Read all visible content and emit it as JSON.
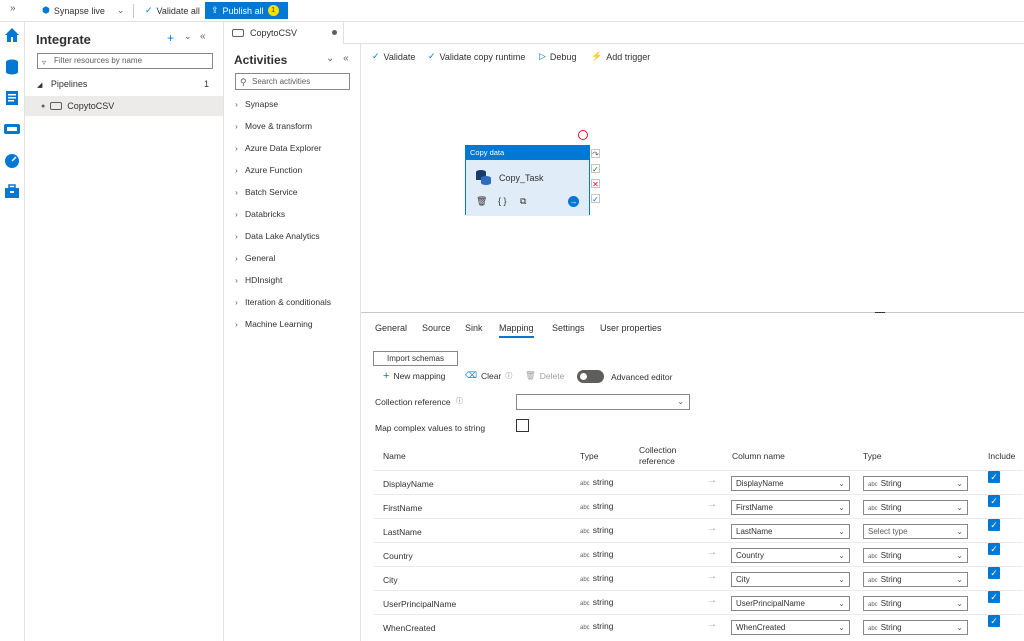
{
  "topbar": {
    "expand_glyph": "»",
    "workspace": "Synapse live",
    "validate_all": "Validate all",
    "publish_all": "Publish all",
    "publish_count": "1"
  },
  "rail": {
    "icons": [
      "home-icon",
      "data-icon",
      "develop-icon",
      "integrate-icon",
      "monitor-icon",
      "manage-icon"
    ]
  },
  "integrate": {
    "title": "Integrate",
    "filter_placeholder": "Filter resources by name",
    "pipelines_label": "Pipelines",
    "pipelines_count": "1",
    "pipeline_name": "CopytoCSV"
  },
  "tab": {
    "name": "CopytoCSV"
  },
  "activities": {
    "title": "Activities",
    "search_placeholder": "Search activities",
    "categories": [
      "Synapse",
      "Move & transform",
      "Azure Data Explorer",
      "Azure Function",
      "Batch Service",
      "Databricks",
      "Data Lake Analytics",
      "General",
      "HDInsight",
      "Iteration & conditionals",
      "Machine Learning"
    ]
  },
  "toolbar": {
    "validate": "Validate",
    "validate_runtime": "Validate copy runtime",
    "debug": "Debug",
    "add_trigger": "Add trigger"
  },
  "node": {
    "type": "Copy data",
    "name": "Copy_Task"
  },
  "props": {
    "tabs": [
      "General",
      "Source",
      "Sink",
      "Mapping",
      "Settings",
      "User properties"
    ],
    "active_tab": "Mapping",
    "import_schemas": "Import schemas",
    "new_mapping": "New mapping",
    "clear": "Clear",
    "delete": "Delete",
    "advanced_editor": "Advanced editor",
    "collection_reference_label": "Collection reference",
    "map_complex_label": "Map complex values to string",
    "headers": {
      "name": "Name",
      "type": "Type",
      "collection_ref_1": "Collection",
      "collection_ref_2": "reference",
      "column_name": "Column name",
      "type2": "Type",
      "include": "Include"
    },
    "type_prefix": "abc",
    "rows": [
      {
        "name": "DisplayName",
        "type": "string",
        "column": "DisplayName",
        "dest_type": "String"
      },
      {
        "name": "FirstName",
        "type": "string",
        "column": "FirstName",
        "dest_type": "String"
      },
      {
        "name": "LastName",
        "type": "string",
        "column": "LastName",
        "dest_type": "Select type"
      },
      {
        "name": "Country",
        "type": "string",
        "column": "Country",
        "dest_type": "String"
      },
      {
        "name": "City",
        "type": "string",
        "column": "City",
        "dest_type": "String"
      },
      {
        "name": "UserPrincipalName",
        "type": "string",
        "column": "UserPrincipalName",
        "dest_type": "String"
      },
      {
        "name": "WhenCreated",
        "type": "string",
        "column": "WhenCreated",
        "dest_type": "String"
      }
    ]
  },
  "colors": {
    "accent": "#0078d4",
    "badge": "#fce100",
    "error": "#e81123"
  }
}
